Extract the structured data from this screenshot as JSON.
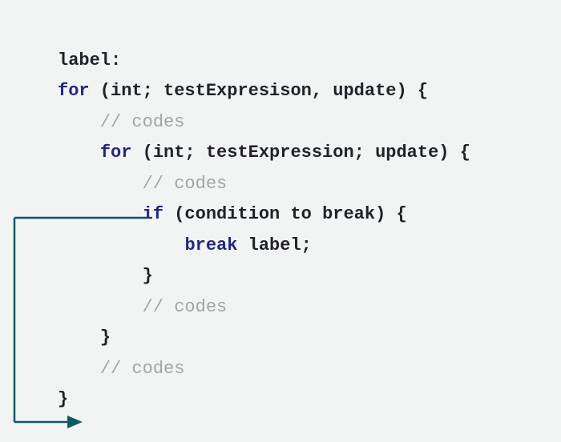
{
  "code": {
    "l1_label": "label:",
    "l2_for": "for",
    "l2_rest": " (int; testExpresison, update) {",
    "l3_comment": "// codes",
    "l4_for": "for",
    "l4_rest": " (int; testExpression; update) {",
    "l5_comment": "// codes",
    "l6_if": "if",
    "l6_rest": " (condition to break) {",
    "l7_break": "break",
    "l7_rest": " label;",
    "l8_brace": "}",
    "l9_comment": "// codes",
    "l10_brace": "}",
    "l11_comment": "// codes",
    "l12_brace": "}"
  }
}
